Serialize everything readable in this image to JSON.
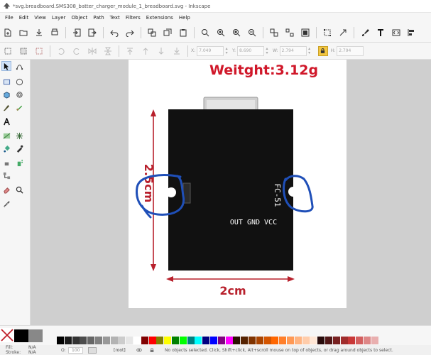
{
  "window": {
    "title": "*svg.breadboard.SMS308_batter_charger_module_1_breadboard.svg - Inkscape"
  },
  "menu": [
    "File",
    "Edit",
    "View",
    "Layer",
    "Object",
    "Path",
    "Text",
    "Filters",
    "Extensions",
    "Help"
  ],
  "controls": {
    "x_label": "X:",
    "x_value": "7.049",
    "y_label": "Y:",
    "y_value": "8.690",
    "w_label": "W:",
    "w_value": "2.794",
    "h_label": "H:",
    "h_value": "2.794"
  },
  "canvas": {
    "weight_text": "Weitght:3.12g",
    "height_label": "2.5cm",
    "width_label": "2cm",
    "module_label": "FC-51",
    "pins_label": "OUT GND VCC"
  },
  "colors": {
    "weight": "#d0182a",
    "dimension": "#b8202c",
    "highlight": "#1f4fb8",
    "module": "#111111"
  },
  "fill_stroke": {
    "fill_label": "Fill:",
    "fill_value": "N/A",
    "stroke_label": "Stroke:",
    "stroke_value": "N/A"
  },
  "status": {
    "opacity_label": "O:",
    "opacity_value": "100",
    "layer": "[root]",
    "message": "No objects selected. Click, Shift+click, Alt+scroll mouse on top of objects, or drag around objects to select."
  },
  "palette": [
    "#000000",
    "#1a1a1a",
    "#333333",
    "#4d4d4d",
    "#666666",
    "#808080",
    "#999999",
    "#b3b3b3",
    "#cccccc",
    "#e6e6e6",
    "#ffffff",
    "#800000",
    "#ff0000",
    "#808000",
    "#ffff00",
    "#008000",
    "#00ff00",
    "#008080",
    "#00ffff",
    "#000080",
    "#0000ff",
    "#800080",
    "#ff00ff",
    "#2b1100",
    "#552200",
    "#803300",
    "#aa4400",
    "#d45500",
    "#ff6600",
    "#ff7f2a",
    "#ff9955",
    "#ffb380",
    "#ffccaa",
    "#ffe6d5",
    "#280b0b",
    "#501616",
    "#782121",
    "#a02c2c",
    "#c83737",
    "#d35f5f",
    "#de8787",
    "#e9afaf"
  ]
}
